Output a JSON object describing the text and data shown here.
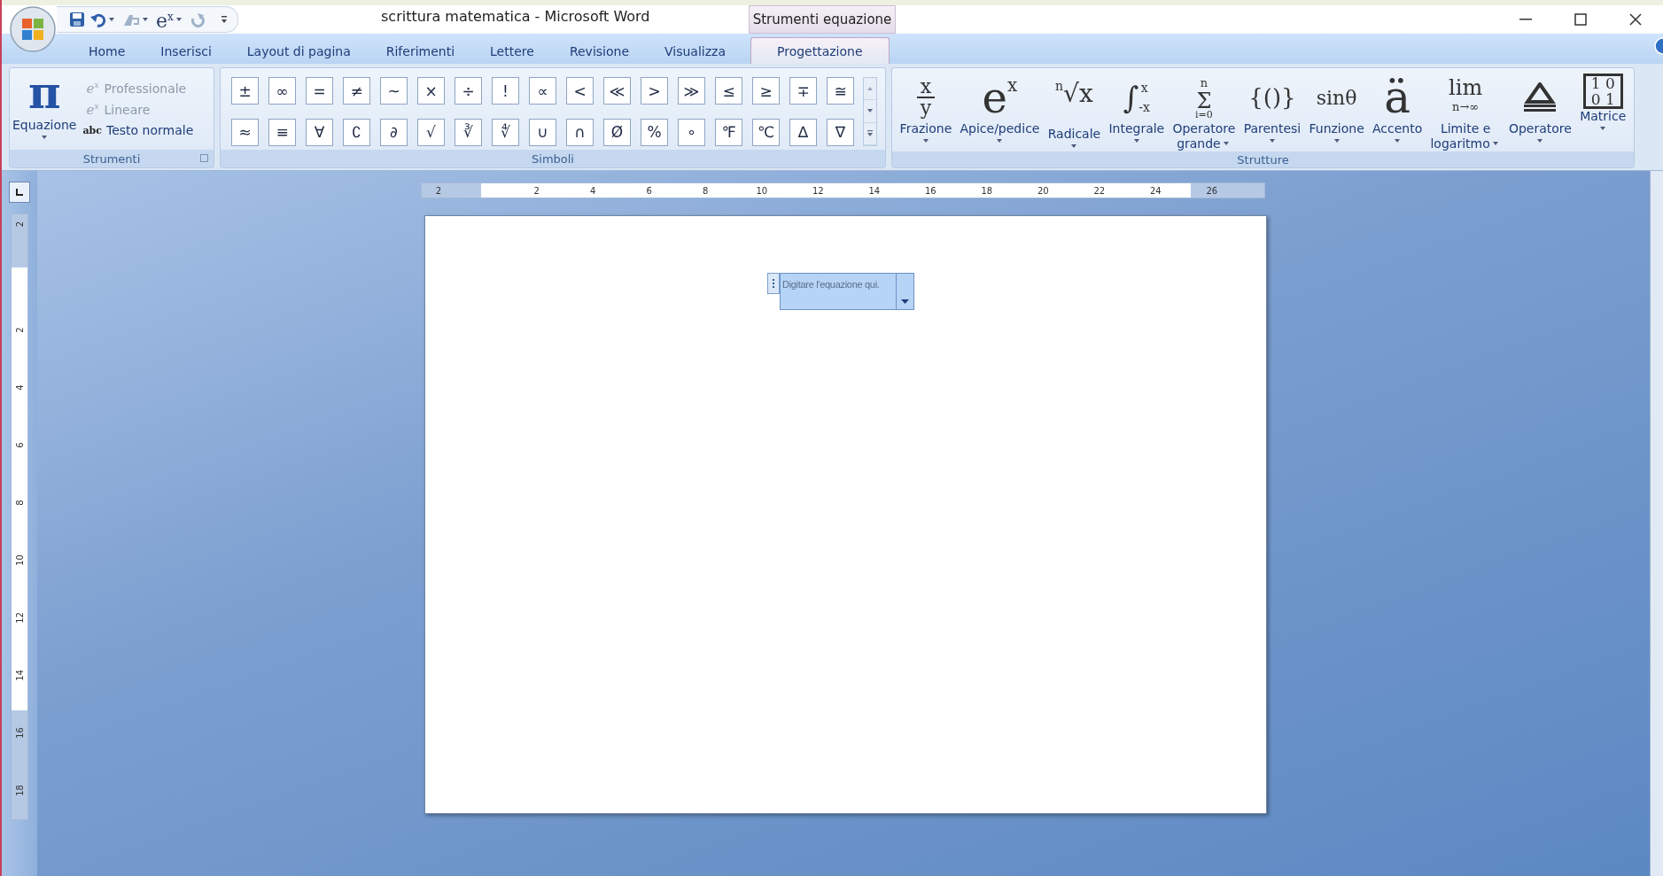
{
  "window": {
    "title": "scrittura matematica - Microsoft Word",
    "contextual_tab": "Strumenti equazione"
  },
  "quick_access": [
    {
      "kind": "save",
      "menu": false
    },
    {
      "kind": "undo",
      "menu": true
    },
    {
      "kind": "format",
      "menu": true
    },
    {
      "kind": "equation",
      "base": "e",
      "sup": "x",
      "menu": true
    },
    {
      "kind": "redo",
      "menu": false
    },
    {
      "kind": "customize",
      "menu": false
    }
  ],
  "tabs": [
    {
      "label": "Home",
      "selected": false
    },
    {
      "label": "Inserisci",
      "selected": false
    },
    {
      "label": "Layout di pagina",
      "selected": false
    },
    {
      "label": "Riferimenti",
      "selected": false
    },
    {
      "label": "Lettere",
      "selected": false
    },
    {
      "label": "Revisione",
      "selected": false
    },
    {
      "label": "Visualizza",
      "selected": false
    },
    {
      "label": "Progettazione",
      "selected": true
    }
  ],
  "tools_group": {
    "label": "Strumenti",
    "equation": {
      "glyph": "π",
      "label": "Equazione"
    },
    "options": [
      {
        "kind": "math",
        "base": "e",
        "sup": "x",
        "label": "Professionale",
        "disabled": true
      },
      {
        "kind": "math",
        "base": "e",
        "sup": "x",
        "label": "Lineare",
        "disabled": true
      },
      {
        "kind": "text",
        "glyph": "abc",
        "label": "Testo normale",
        "disabled": false
      }
    ]
  },
  "symbols_group": {
    "label": "Simboli",
    "rows": [
      [
        "±",
        "∞",
        "=",
        "≠",
        "~",
        "×",
        "÷",
        "!",
        "∝",
        "<",
        "≪",
        ">",
        "≫",
        "≤",
        "≥",
        "∓",
        "≅"
      ],
      [
        "≈",
        "≡",
        "∀",
        "∁",
        "∂",
        "√",
        "∛",
        "∜",
        "∪",
        "∩",
        "Ø",
        "%",
        "∘",
        "℉",
        "℃",
        "∆",
        "∇"
      ]
    ]
  },
  "structures_group": {
    "label": "Strutture",
    "items": [
      {
        "kind": "fraction",
        "parts": [
          "x",
          "y"
        ],
        "label": [
          "Frazione"
        ]
      },
      {
        "kind": "script",
        "parts": [
          "e",
          "x"
        ],
        "label": [
          "Apice/pedice"
        ]
      },
      {
        "kind": "radical",
        "parts": [
          "n",
          "√x"
        ],
        "label": [
          "Radicale"
        ]
      },
      {
        "kind": "integral",
        "parts": [
          "∫",
          "x",
          "-x"
        ],
        "label": [
          "Integrale"
        ]
      },
      {
        "kind": "large_operator",
        "parts": [
          "n",
          "Σ",
          "i=0"
        ],
        "label": [
          "Operatore",
          "grande"
        ]
      },
      {
        "kind": "bracket",
        "parts": [
          "{()}"
        ],
        "label": [
          "Parentesi"
        ]
      },
      {
        "kind": "function",
        "parts": [
          "sinθ"
        ],
        "label": [
          "Funzione"
        ]
      },
      {
        "kind": "accent",
        "parts": [
          "ä"
        ],
        "label": [
          "Accento"
        ]
      },
      {
        "kind": "limit",
        "parts": [
          "lim",
          "n→∞"
        ],
        "label": [
          "Limite e",
          "logaritmo"
        ]
      },
      {
        "kind": "operator",
        "label": [
          "Operatore"
        ]
      },
      {
        "kind": "matrix",
        "parts": [
          "1 0",
          "0 1"
        ],
        "label": [
          "Matrice"
        ]
      }
    ]
  },
  "ruler": {
    "horizontal": [
      "2",
      "2",
      "4",
      "6",
      "8",
      "10",
      "12",
      "14",
      "16",
      "18",
      "20",
      "22",
      "24",
      "26"
    ],
    "vertical": [
      "2",
      "2",
      "4",
      "6",
      "8",
      "10",
      "12",
      "14",
      "16",
      "18"
    ]
  },
  "document": {
    "equation_placeholder": "Digitare l'equazione qui."
  }
}
